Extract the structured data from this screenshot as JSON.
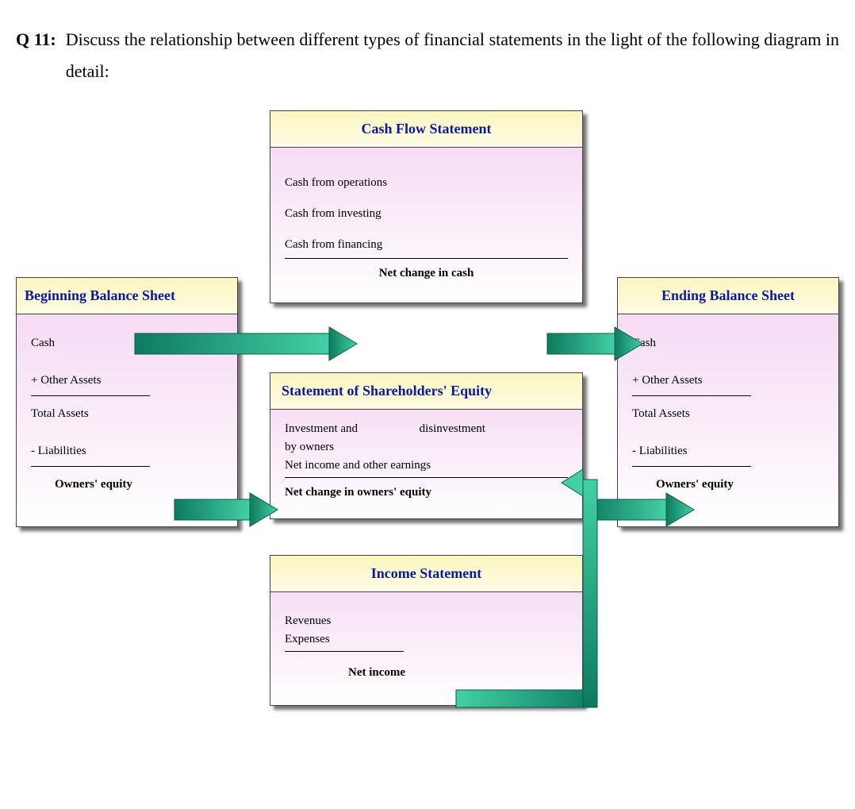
{
  "question": {
    "label": "Q 11:",
    "text": "Discuss the relationship between different types of financial statements in the light of the following diagram in detail:"
  },
  "beginning_bs": {
    "title": "Beginning Balance Sheet",
    "cash": "Cash",
    "other_assets": "+ Other Assets",
    "total_assets": "Total Assets",
    "liabilities": "- Liabilities",
    "owners_equity": "Owners' equity"
  },
  "ending_bs": {
    "title": "Ending Balance Sheet",
    "cash": "Cash",
    "other_assets": "+ Other Assets",
    "total_assets": "Total Assets",
    "liabilities": "- Liabilities",
    "owners_equity": "Owners' equity"
  },
  "cash_flow": {
    "title": "Cash Flow Statement",
    "ops": "Cash from operations",
    "inv": "Cash from investing",
    "fin": "Cash from financing",
    "net": "Net change in cash"
  },
  "equity": {
    "title": "Statement of Shareholders' Equity",
    "line1a": "Investment and",
    "line1b": "disinvestment",
    "line2": "by owners",
    "line3": "Net income and other earnings",
    "net": "Net change in owners' equity"
  },
  "income": {
    "title": "Income Statement",
    "rev": "Revenues",
    "exp": "Expenses",
    "net": "Net income"
  }
}
